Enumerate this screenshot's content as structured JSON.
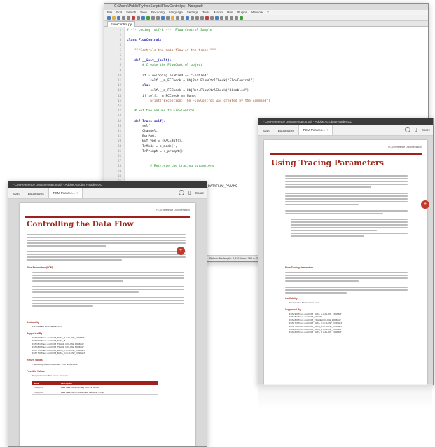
{
  "editor": {
    "title": "C:\\Users\\Public\\PythonScripts\\FlowControl.py - Notepad++",
    "menu": [
      "File",
      "Edit",
      "Search",
      "View",
      "Encoding",
      "Language",
      "Settings",
      "Tools",
      "Macro",
      "Run",
      "Plugins",
      "Window",
      "?"
    ],
    "tab": "FlowControl.py",
    "code_lines": [
      {
        "n": "1",
        "t": "# -*- coding: utf-8 -*-  Flow Control Sample",
        "c": "cm"
      },
      {
        "n": "2",
        "t": "",
        "c": "nm"
      },
      {
        "n": "3",
        "t": "class FlowControl:",
        "c": "kw"
      },
      {
        "n": "4",
        "t": "",
        "c": "nm"
      },
      {
        "n": "5",
        "t": "    \"\"\"Controls the data flow of the trace.\"\"\"",
        "c": "st"
      },
      {
        "n": "6",
        "t": "",
        "c": "nm"
      },
      {
        "n": "7",
        "t": "    def __init__(self):",
        "c": "kw"
      },
      {
        "n": "8",
        "t": "        # Create the FlowControl object",
        "c": "cm"
      },
      {
        "n": "9",
        "t": "",
        "c": "nm"
      },
      {
        "n": "10",
        "t": "        if FlowConfig.enabled == \"Enabled\":",
        "c": "nm"
      },
      {
        "n": "11",
        "t": "            self.__m_FCCheck = ObjRef.FlowCtrlCheck(\"FlowControl\")",
        "c": "nm"
      },
      {
        "n": "12",
        "t": "        else:",
        "c": "kw"
      },
      {
        "n": "13",
        "t": "            self.__m_FCCheck = ObjRef.FlowCtrlCheck(\"Disabled\")",
        "c": "nm"
      },
      {
        "n": "14",
        "t": "        if self.__m_FCCheck == None:",
        "c": "nm"
      },
      {
        "n": "15",
        "t": "            print(\"Exception: The FlowControl was created by the command\")",
        "c": "st"
      },
      {
        "n": "16",
        "t": "",
        "c": "nm"
      },
      {
        "n": "17",
        "t": "    # Set the values to FlowControl",
        "c": "cm"
      },
      {
        "n": "18",
        "t": "",
        "c": "nm"
      },
      {
        "n": "19",
        "t": "    def Trace(self):",
        "c": "kw"
      },
      {
        "n": "20",
        "t": "        self.",
        "c": "nm"
      },
      {
        "n": "21",
        "t": "        Channel,",
        "c": "nm"
      },
      {
        "n": "22",
        "t": "        BurPAG,",
        "c": "nm"
      },
      {
        "n": "23",
        "t": "        BufType = TRACEBuf(),",
        "c": "nm"
      },
      {
        "n": "24",
        "t": "        TrMode = s_mode(),",
        "c": "nm"
      },
      {
        "n": "25",
        "t": "        TrPrompt = s_prompt(),",
        "c": "nm"
      },
      {
        "n": "26",
        "t": "",
        "c": "nm"
      },
      {
        "n": "27",
        "t": "",
        "c": "nm"
      },
      {
        "n": "28",
        "t": "            # Retrieve the tracing parameters",
        "c": "cm"
      },
      {
        "n": "29",
        "t": "",
        "c": "nm"
      },
      {
        "n": "30",
        "t": "",
        "c": "nm"
      },
      {
        "n": "31",
        "t": "",
        "c": "nm"
      },
      {
        "n": "32",
        "t": "                                    TRACE_DATAFLOW_PARAMS",
        "c": "nm"
      }
    ],
    "status": "Python file    length: 2,481    lines: 78    Ln: 32  Col: 48    Windows (CR LF)    UTF-8    INS"
  },
  "pdf_left": {
    "titlebar": "FCM Reference Documentation.pdf - Adobe Acrobat Reader DC",
    "tabs": [
      "Start",
      "Bookmarks",
      "FCM Parame..."
    ],
    "tab_close": "×",
    "share_label": "Share",
    "header_right": "FCM Reference Documentation",
    "title": "Controlling the Data Flow",
    "sections": [
      "Flow Parameters (FCM)",
      "Availability",
      "Supported By",
      "Return Values",
      "Possible Values"
    ],
    "availability": "For installed FCM version 1.0.0",
    "supported_by": [
      "FCM 9.0 Trace and FCM_DATA_A in FLOW_FORMAT",
      "FCM 9.0 Trace and FCM_DATA_B",
      "FCM 8.1 Trace and FCM_TRACE in FLOW_FORMAT",
      "FCM 8.0 Trace and FCM_TRACE in FLOW_FORMAT",
      "FCM 7.3 Trace and FCM_DATA_C in FLOW_FORMAT",
      "FCM 7.0 Trace and FCM_DATA_D in FLOW_FORMAT"
    ],
    "return_values": "The tracing status is returned. True on success.",
    "possible_values": "The parameters that can be used are:",
    "table_headers": [
      "Name",
      "Description"
    ],
    "table_rows": [
      [
        "FCM_ON",
        "Data trace flows normally from the source"
      ],
      [
        "FCM_OFF",
        "Data trace flow is suspended, the buffer is kept"
      ]
    ],
    "fab": "+"
  },
  "pdf_right": {
    "titlebar": "FCM Reference Documentation.pdf - Adobe Acrobat Reader DC",
    "tabs": [
      "Start",
      "Bookmarks",
      "FCM Parame..."
    ],
    "tab_close": "×",
    "share_label": "Share",
    "header_right": "FCM Reference Documentation",
    "title": "Using Tracing Parameters",
    "sections": [
      "Flow Tracing Parameters",
      "Availability",
      "Supported By"
    ],
    "availability": "For installed FCM version 1.0.0",
    "supported_by": [
      "FCM 9.0 Trace and FCM_DATA_A in FLOW_FORMAT",
      "FCM 8.1 Trace and FCM_TRACE",
      "FCM 8.0 Trace and FCM_TRACE in FLOW_FORMAT",
      "FCM 7.3 Trace and FCM_DATA_C in FLOW_FORMAT",
      "FCM 7.0 Trace and FCM_DATA_D in FLOW_FORMAT",
      "FCM 6.5 Trace and FCM_DATA_E in FLOW_FORMAT",
      "FCM 6.0 Trace and FCM_DATA_F in FLOW_FORMAT"
    ],
    "fab": "+"
  },
  "colors": {
    "accent": "#a0201e",
    "editor_keyword": "#1a1ab0",
    "editor_comment": "#1e8c1e"
  }
}
